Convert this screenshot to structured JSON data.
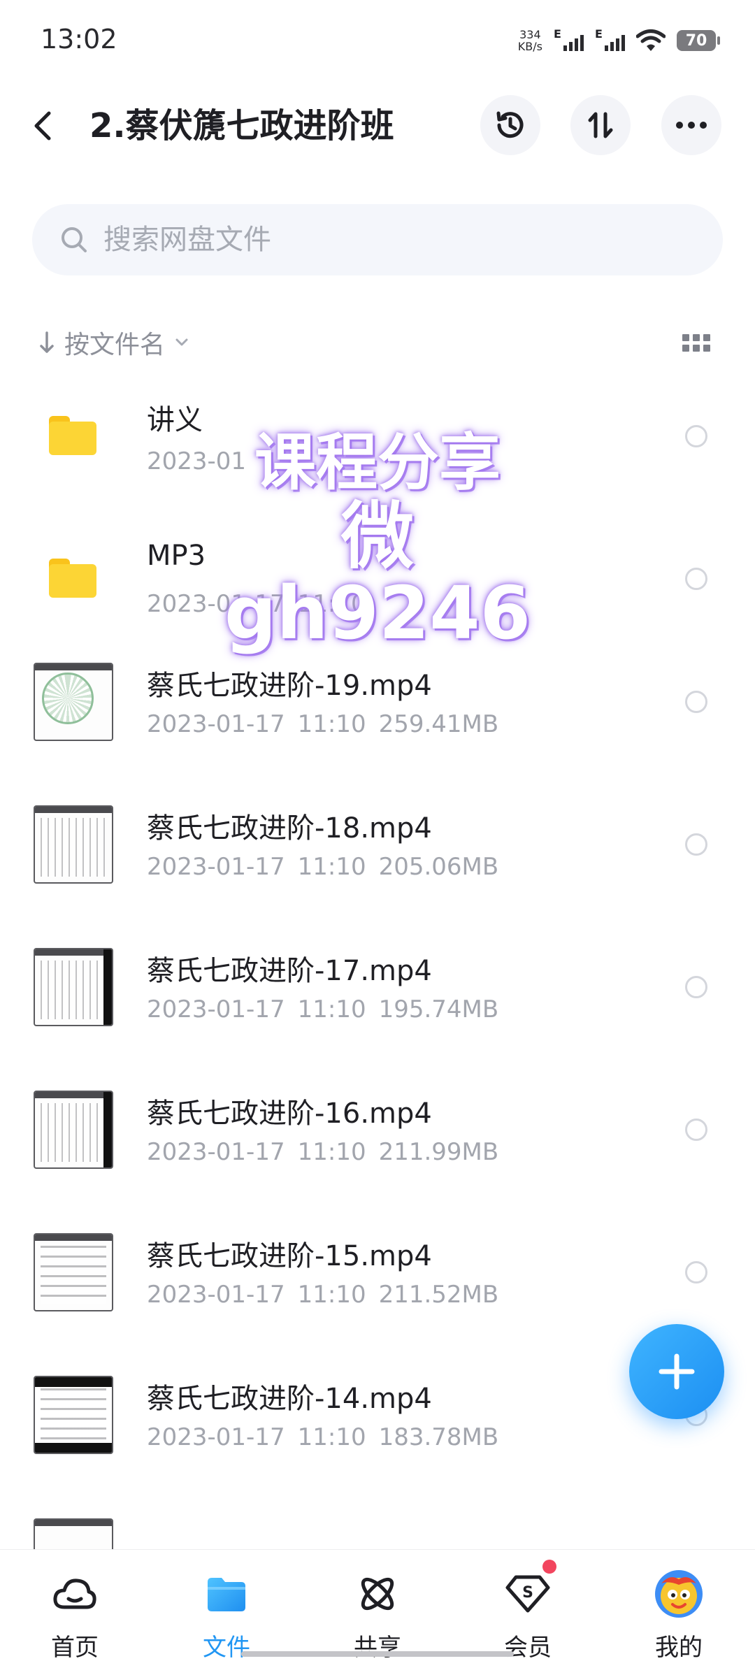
{
  "status_bar": {
    "time": "13:02",
    "net_speed_value": "334",
    "net_speed_unit": "KB/s",
    "network_type_1": "E",
    "network_type_2": "E",
    "battery": "70"
  },
  "header": {
    "title": "2.蔡伏篪七政进阶班",
    "icons": [
      "back-arrow-icon",
      "history-icon",
      "sort-icon",
      "more-icon"
    ]
  },
  "search": {
    "placeholder": "搜索网盘文件"
  },
  "sort": {
    "label": "按文件名"
  },
  "watermark": {
    "line1": "课程分享",
    "line2": "微gh9246"
  },
  "files": [
    {
      "type": "folder",
      "name": "讲义",
      "date": "2023-01",
      "time": "",
      "size": ""
    },
    {
      "type": "folder",
      "name": "MP3",
      "date": "2023-01-17",
      "time": "11:10",
      "size": ""
    },
    {
      "type": "video",
      "name": "蔡氏七政进阶-19.mp4",
      "date": "2023-01-17",
      "time": "11:10",
      "size": "259.41MB"
    },
    {
      "type": "video",
      "name": "蔡氏七政进阶-18.mp4",
      "date": "2023-01-17",
      "time": "11:10",
      "size": "205.06MB"
    },
    {
      "type": "video",
      "name": "蔡氏七政进阶-17.mp4",
      "date": "2023-01-17",
      "time": "11:10",
      "size": "195.74MB"
    },
    {
      "type": "video",
      "name": "蔡氏七政进阶-16.mp4",
      "date": "2023-01-17",
      "time": "11:10",
      "size": "211.99MB"
    },
    {
      "type": "video",
      "name": "蔡氏七政进阶-15.mp4",
      "date": "2023-01-17",
      "time": "11:10",
      "size": "211.52MB"
    },
    {
      "type": "video",
      "name": "蔡氏七政进阶-14.mp4",
      "date": "2023-01-17",
      "time": "11:10",
      "size": "183.78MB"
    }
  ],
  "bottom_nav": {
    "items": [
      {
        "label": "首页",
        "icon": "cloud-icon"
      },
      {
        "label": "文件",
        "icon": "folder-icon"
      },
      {
        "label": "共享",
        "icon": "atom-icon"
      },
      {
        "label": "会员",
        "icon": "vip-diamond-icon"
      },
      {
        "label": "我的",
        "icon": "avatar-icon"
      }
    ],
    "active_index": 1
  },
  "colors": {
    "accent": "#2196f3",
    "folder": "#fcd535",
    "badge": "#f2455e"
  }
}
